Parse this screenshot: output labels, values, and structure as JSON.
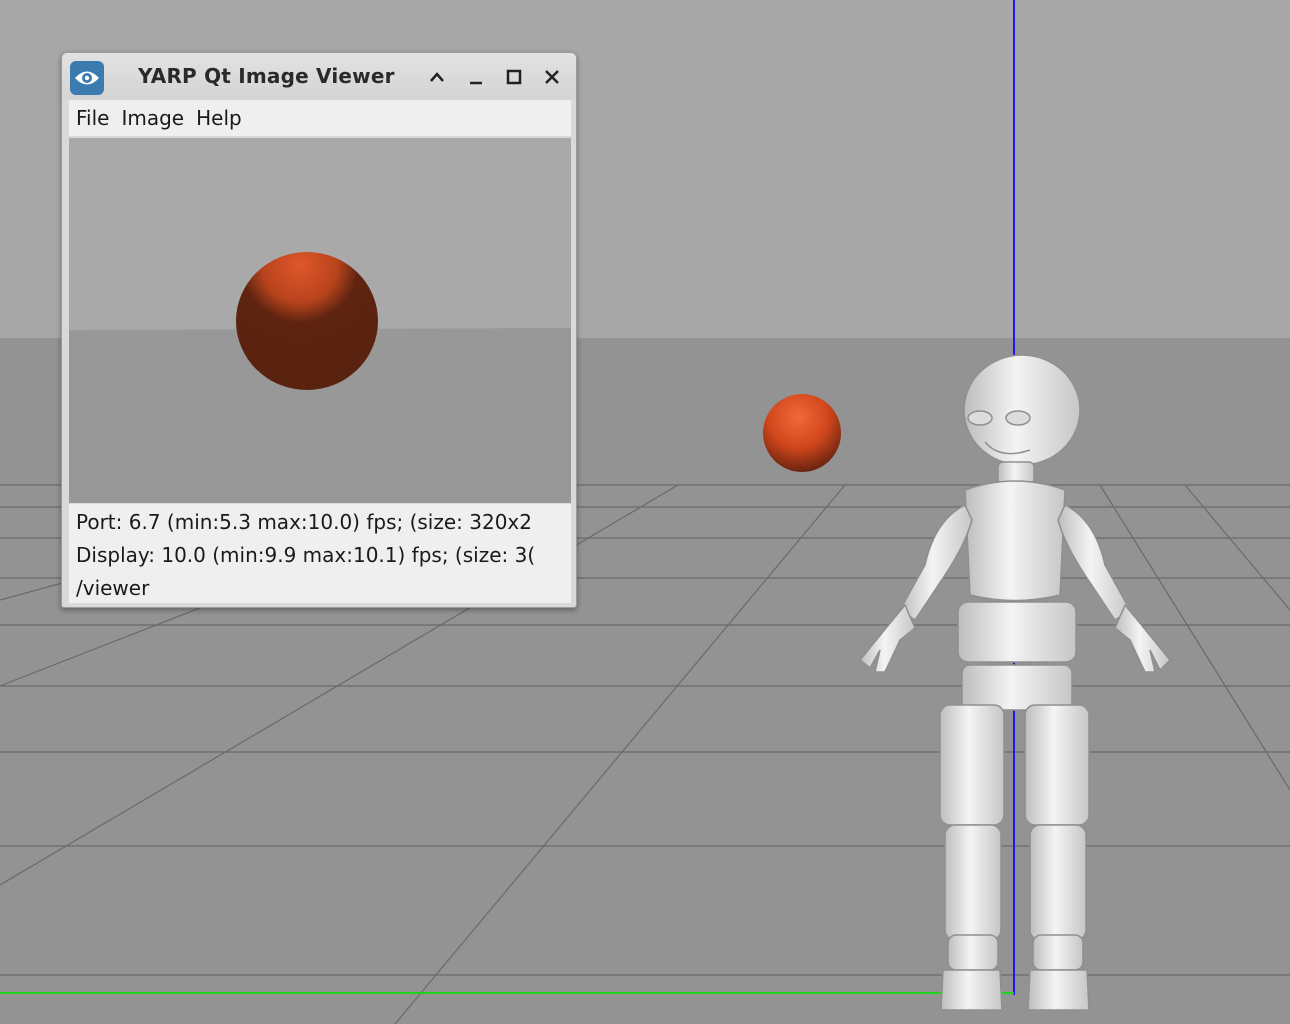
{
  "window": {
    "title": "YARP Qt Image Viewer",
    "icon": "eye-icon",
    "controls": [
      "chevron-up-icon",
      "minimize-icon",
      "maximize-icon",
      "close-icon"
    ]
  },
  "menu": {
    "items": [
      "File",
      "Image",
      "Help"
    ]
  },
  "status": {
    "port_line": "Port: 6.7 (min:5.3 max:10.0) fps; (size: 320x2",
    "display_line": "Display: 10.0 (min:9.9 max:10.1) fps; (size: 3(",
    "port_name": "/viewer"
  },
  "colors": {
    "sky": "#a8a8a8",
    "ground": "#929292",
    "ball": "#c8461e",
    "z_axis": "#1a1aff",
    "x_axis": "#1ed21e"
  }
}
